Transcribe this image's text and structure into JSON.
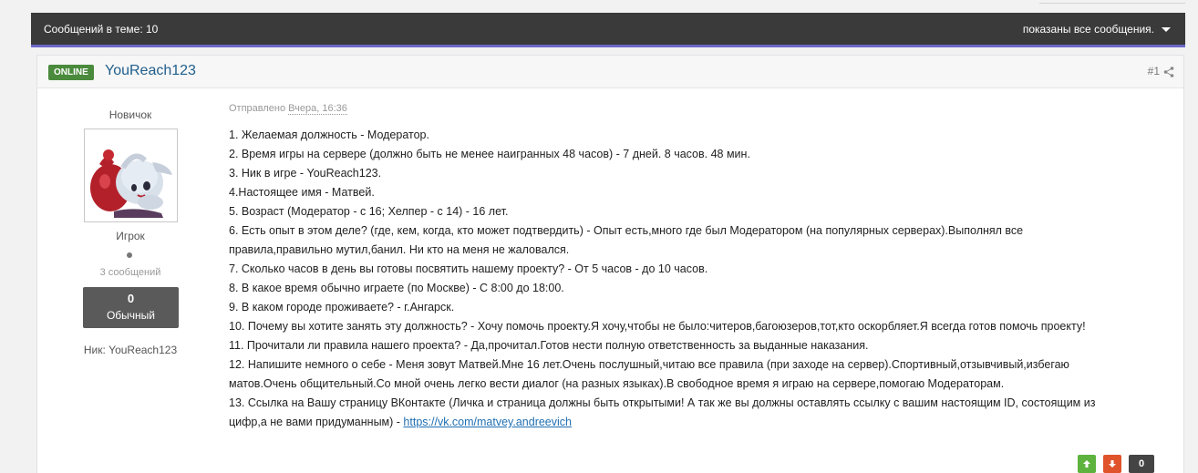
{
  "topic_bar": {
    "message_count": "Сообщений в теме: 10",
    "filter_label": "показаны все сообщения."
  },
  "post": {
    "status_badge": "ONLINE",
    "author": "YouReach123",
    "number": "#1",
    "author_info": {
      "rank": "Новичок",
      "group": "Игрок",
      "post_count": "3 сообщений",
      "reputation_value": "0",
      "reputation_label": "Обычный",
      "nick": "Ник: YouReach123"
    },
    "sent_prefix": "Отправлено",
    "sent_date": "Вчера, 16:36",
    "lines": [
      "1. Желаемая должность - Модератор.",
      "2. Время игры на сервере (должно быть не менее наигранных 48 часов) - 7 дней. 8 часов. 48 мин.",
      "3. Ник в игре - YouReach123.",
      "4.Настоящее имя - Матвей.",
      "5. Возраст (Модератор - с 16; Хелпер - с 14) - 16 лет.",
      "6. Есть опыт в этом деле? (где, кем, когда, кто может подтвердить) - Опыт есть,много где был Модератором (на популярных серверах).Выполнял все",
      "правила,правильно мутил,банил. Ни кто на меня не жаловался.",
      "7. Сколько часов в день вы готовы посвятить нашему проекту? - От 5 часов - до 10 часов.",
      "8. В какое время обычно играете (по Москве) - С 8:00 до 18:00.",
      "9. В каком городе проживаете? - г.Ангарск.",
      "10. Почему вы хотите занять эту должность? - Хочу помочь проекту.Я хочу,чтобы не было:читеров,багоюзеров,тот,кто оскорбляет.Я всегда готов помочь проекту!",
      "11. Прочитали ли правила нашего проекта? - Да,прочитал.Готов нести полную ответственность за выданные наказания.",
      "12. Напишите немного о себе - Меня зовут Матвей.Мне 16 лет.Очень послушный,читаю все правила (при заходе на сервер).Спортивный,отзывчивый,избегаю",
      "матов.Очень общительный.Со мной очень легко вести диалог (на разных языках).В свободное время я играю на сервере,помогаю Модераторам.",
      "13. Ссылка на Вашу страницу ВКонтакте (Личка и страница должны быть открытыми! А так же вы должны оставлять ссылку с вашим настоящим ID, состоящим из"
    ],
    "last_line_prefix": "цифр,а не вами придуманным) - ",
    "vk_link": "https://vk.com/matvey.andreevich",
    "vote_score": "0"
  },
  "colors": {
    "topic_bar_bg": "#3a3a3a",
    "topic_bar_accent": "#6b68c9",
    "online_badge": "#4a8a3c",
    "author_link": "#1f5e8c",
    "vote_up": "#5db33e",
    "vote_down": "#e0542b"
  },
  "icons": {
    "filter": "caret-down-icon",
    "share": "share-icon",
    "vote_up": "arrow-up-icon",
    "vote_down": "arrow-down-icon"
  }
}
